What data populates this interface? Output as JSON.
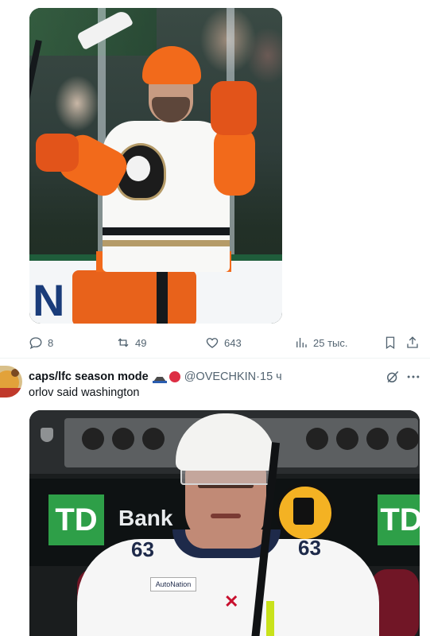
{
  "tweet1": {
    "media_alt": "hockey player celebrating",
    "media_board_letter": "N",
    "actions": {
      "replies": "8",
      "reposts": "49",
      "likes": "643",
      "views": "25 тыс."
    }
  },
  "tweet2": {
    "author_name": "caps/lfc season mode",
    "handle": "@OVECHKIN",
    "separator": " · ",
    "time": "15 ч",
    "text": "orlov said washington",
    "media": {
      "sponsor_logo": "TD",
      "sponsor_word": "Bank",
      "jersey_number": "63",
      "patch_text": "AutoNation"
    }
  },
  "colors": {
    "muted": "#536471",
    "text": "#0f1419",
    "divider": "#eff3f4",
    "td_green": "#2e9f48",
    "ducks_orange": "#f26a1b"
  },
  "icons": [
    "reply-icon",
    "repost-icon",
    "like-icon",
    "views-icon",
    "bookmark-icon",
    "share-icon",
    "grok-icon",
    "more-icon"
  ]
}
